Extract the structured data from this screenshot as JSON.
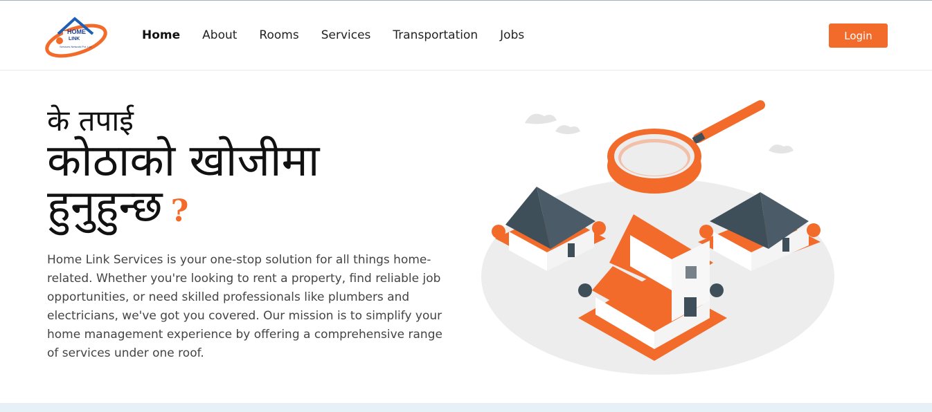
{
  "brand": {
    "logo_line1": "HOME",
    "logo_line2": "LINK",
    "logo_line3": "Services Network Pvt. Ltd."
  },
  "nav": {
    "items": [
      {
        "label": "Home",
        "active": true
      },
      {
        "label": "About"
      },
      {
        "label": "Rooms"
      },
      {
        "label": "Services"
      },
      {
        "label": "Transportation"
      },
      {
        "label": "Jobs"
      }
    ],
    "login_label": "Login"
  },
  "hero": {
    "title_line1": "के तपाई",
    "title_line2": "कोठाको खोजीमा",
    "title_line3": "हुनुहुन्छ",
    "title_mark": "?",
    "description": "Home Link Services is your one-stop solution for all things home-related. Whether you're looking to rent a property, find reliable job opportunities, or need skilled professionals like plumbers and electricians, we've got you covered. Our mission is to simplify your home management experience by offering a comprehensive range of services under one roof."
  },
  "colors": {
    "accent": "#f26b2a",
    "dark_roof": "#3f4f5a",
    "ground": "#ededed"
  }
}
